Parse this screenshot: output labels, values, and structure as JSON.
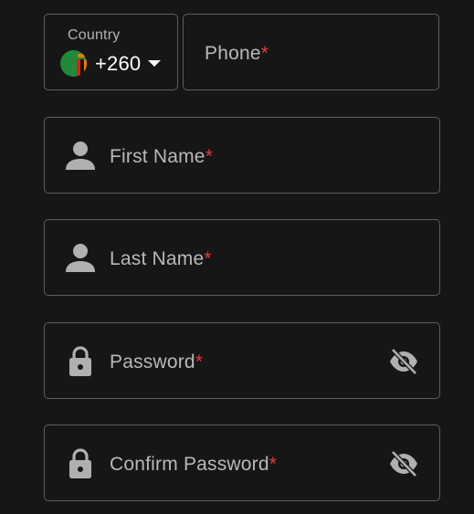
{
  "country_picker": {
    "label": "Country",
    "dial_code": "+260",
    "flag_icon": "zambia-flag-icon"
  },
  "phone": {
    "placeholder": "Phone",
    "required_mark": "*"
  },
  "first_name": {
    "placeholder": "First Name",
    "required_mark": "*",
    "icon": "person-icon"
  },
  "last_name": {
    "placeholder": "Last Name",
    "required_mark": "*",
    "icon": "person-icon"
  },
  "password": {
    "placeholder": "Password",
    "required_mark": "*",
    "icon": "lock-icon",
    "toggle_icon": "eye-off-icon"
  },
  "confirm_password": {
    "placeholder": "Confirm Password",
    "required_mark": "*",
    "icon": "lock-icon",
    "toggle_icon": "eye-off-icon"
  },
  "colors": {
    "background": "#161616",
    "border": "#5d5d5d",
    "label": "#b9b9b9",
    "required": "#e53935",
    "icon": "#b0b0b0"
  }
}
